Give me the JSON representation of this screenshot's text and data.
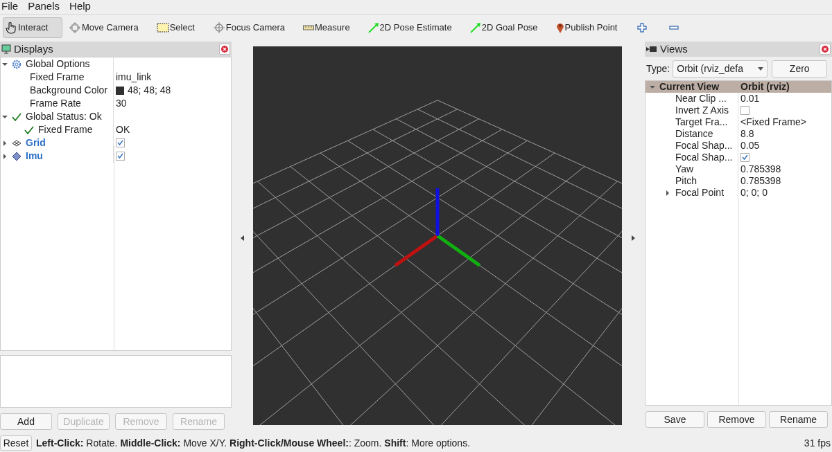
{
  "menu": [
    {
      "label": "File"
    },
    {
      "label": "Panels"
    },
    {
      "label": "Help"
    }
  ],
  "toolbar": [
    {
      "label": "Interact",
      "kind": "interact",
      "selected": true
    },
    {
      "label": "Move Camera",
      "kind": "move",
      "selected": false
    },
    {
      "label": "Select",
      "kind": "select",
      "selected": false
    },
    {
      "label": "Focus Camera",
      "kind": "focus",
      "selected": false
    },
    {
      "label": "Measure",
      "kind": "measure",
      "selected": false
    },
    {
      "label": "2D Pose Estimate",
      "kind": "pose",
      "selected": false
    },
    {
      "label": "2D Goal Pose",
      "kind": "pose",
      "selected": false
    },
    {
      "label": "Publish Point",
      "kind": "point",
      "selected": false
    },
    {
      "kind": "add",
      "selected": false
    },
    {
      "kind": "remove",
      "selected": false
    }
  ],
  "displays": {
    "title": "Displays",
    "tree": [
      {
        "label": "Global Options",
        "kind": "options",
        "expanded": true,
        "children": [
          {
            "label": "Fixed Frame",
            "kind": "property",
            "value": "imu_link"
          },
          {
            "label": "Background Color",
            "kind": "property",
            "value": "48; 48; 48",
            "color": "#303030"
          },
          {
            "label": "Frame Rate",
            "kind": "property",
            "value": "30"
          }
        ]
      },
      {
        "label": "Global Status: Ok",
        "kind": "status",
        "expanded": true,
        "children": [
          {
            "label": "Fixed Frame",
            "kind": "status",
            "value": "OK"
          }
        ]
      },
      {
        "label": "Grid",
        "kind": "grid",
        "expanded": false,
        "checked": true
      },
      {
        "label": "Imu",
        "kind": "imu",
        "expanded": false,
        "checked": true
      }
    ],
    "buttons": [
      {
        "label": "Add",
        "disabled": false
      },
      {
        "label": "Duplicate",
        "disabled": true
      },
      {
        "label": "Remove",
        "disabled": true
      },
      {
        "label": "Rename",
        "disabled": true
      }
    ]
  },
  "views": {
    "title": "Views",
    "type_label": "Type:",
    "type_value": "Orbit (rviz_defa",
    "zero_button": "Zero",
    "header": {
      "label": "Current View",
      "value": "Orbit (rviz)",
      "expanded": true
    },
    "properties": [
      {
        "label": "Near Clip ...",
        "kind": "text",
        "value": "0.01"
      },
      {
        "label": "Invert Z Axis",
        "kind": "check",
        "checked": false
      },
      {
        "label": "Target Fra...",
        "kind": "text",
        "value": "<Fixed Frame>"
      },
      {
        "label": "Distance",
        "kind": "text",
        "value": "8.8"
      },
      {
        "label": "Focal Shap...",
        "kind": "text",
        "value": "0.05"
      },
      {
        "label": "Focal Shap...",
        "kind": "check",
        "checked": true
      },
      {
        "label": "Yaw",
        "kind": "text",
        "value": "0.785398"
      },
      {
        "label": "Pitch",
        "kind": "text",
        "value": "0.785398"
      },
      {
        "label": "Focal Point",
        "kind": "text",
        "value": "0; 0; 0",
        "expanded": false
      }
    ],
    "buttons": [
      {
        "label": "Save"
      },
      {
        "label": "Remove"
      },
      {
        "label": "Rename"
      }
    ]
  },
  "status_bar": {
    "reset": "Reset",
    "hint": "**Left-Click:** Rotate. **Middle-Click:** Move X/Y. **Right-Click/Mouse Wheel:**: Zoom. **Shift**: More options.",
    "fps": "31 fps"
  }
}
